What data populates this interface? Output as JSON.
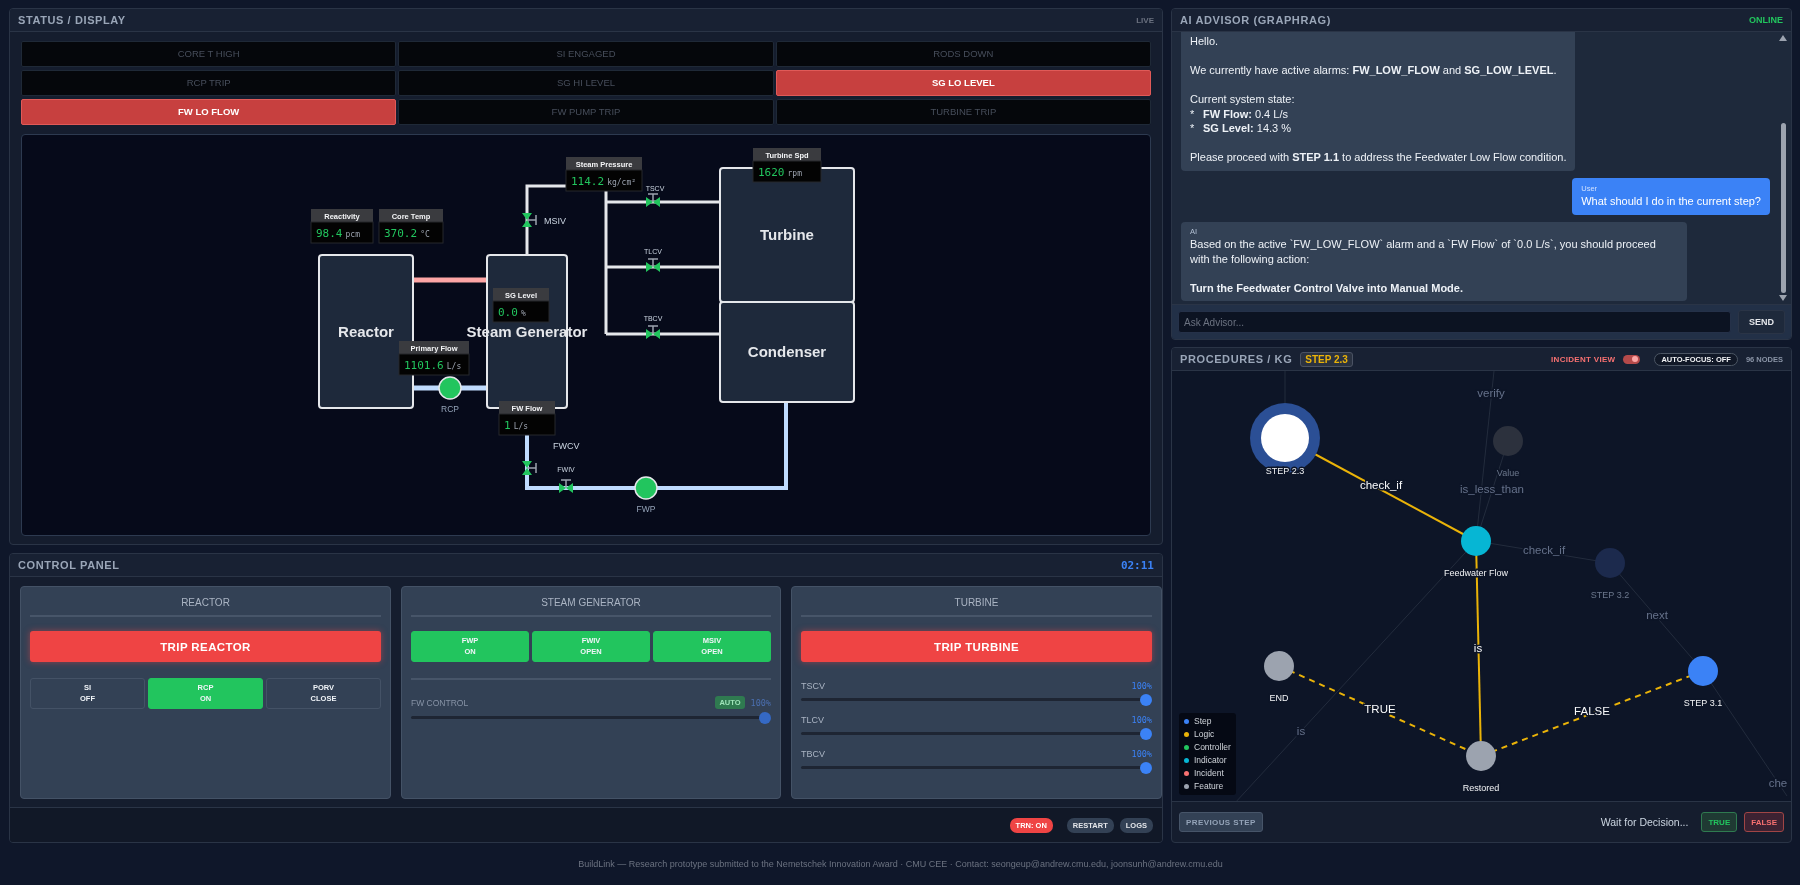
{
  "status_panel": {
    "title": "STATUS / DISPLAY",
    "badge": "LIVE",
    "alarms": [
      {
        "label": "CORE T HIGH",
        "active": false
      },
      {
        "label": "SI ENGAGED",
        "active": false
      },
      {
        "label": "RODS DOWN",
        "active": false
      },
      {
        "label": "RCP TRIP",
        "active": false
      },
      {
        "label": "SG HI LEVEL",
        "active": false
      },
      {
        "label": "SG LO LEVEL",
        "active": true
      },
      {
        "label": "FW LO FLOW",
        "active": true
      },
      {
        "label": "FW PUMP TRIP",
        "active": false
      },
      {
        "label": "TURBINE TRIP",
        "active": false
      }
    ],
    "diagram": {
      "components": [
        {
          "label": "Reactor"
        },
        {
          "label": "Steam Generator"
        },
        {
          "label": "Turbine"
        },
        {
          "label": "Condenser"
        }
      ],
      "gauges": [
        {
          "label": "Turbine Spd",
          "value": "1620",
          "unit": "rpm"
        },
        {
          "label": "Steam Pressure",
          "value": "114.2",
          "unit": "kg/cm²"
        },
        {
          "label": "Reactivity",
          "value": "98.4",
          "unit": "pcm"
        },
        {
          "label": "Core Temp",
          "value": "370.2",
          "unit": "°C"
        },
        {
          "label": "SG Level",
          "value": "0.0",
          "unit": "%"
        },
        {
          "label": "Primary Flow",
          "value": "1101.6",
          "unit": "L/s"
        },
        {
          "label": "FW Flow",
          "value": "1",
          "unit": "L/s"
        }
      ],
      "valves": [
        {
          "label": "MSIV",
          "open": true
        },
        {
          "label": "TSCV",
          "open": true
        },
        {
          "label": "TLCV",
          "open": true
        },
        {
          "label": "TBCV",
          "open": true
        },
        {
          "label": "FWCV",
          "open": true
        },
        {
          "label": "FWIV",
          "open": true
        }
      ],
      "pumps": [
        {
          "label": "RCP",
          "running": true
        },
        {
          "label": "FWP",
          "running": true
        }
      ]
    }
  },
  "control_panel": {
    "title": "CONTROL PANEL",
    "clock": "02:11",
    "sections": [
      {
        "title": "REACTOR",
        "trip_button": "TRIP REACTOR",
        "toggles": [
          {
            "name": "SI",
            "state": "OFF",
            "on": false
          },
          {
            "name": "RCP",
            "state": "ON",
            "on": true
          },
          {
            "name": "PORV",
            "state": "CLOSE",
            "on": false
          }
        ]
      },
      {
        "title": "STEAM GENERATOR",
        "toggles": [
          {
            "name": "FWP",
            "state": "ON",
            "on": true
          },
          {
            "name": "FWIV",
            "state": "OPEN",
            "on": true
          },
          {
            "name": "MSIV",
            "state": "OPEN",
            "on": true
          }
        ],
        "control": {
          "label": "FW CONTROL",
          "mode": "AUTO",
          "auto": true,
          "reading": "100%",
          "level": 1
        }
      },
      {
        "title": "TURBINE",
        "trip_button": "TRIP TURBINE",
        "sliders": [
          {
            "label": "TSCV",
            "reading": "100%",
            "level": 1
          },
          {
            "label": "TLCV",
            "reading": "100%",
            "level": 1
          },
          {
            "label": "TBCV",
            "reading": "100%",
            "level": 1
          }
        ]
      }
    ],
    "footer_buttons": [
      {
        "label": "TRN: ON",
        "kind": "alert"
      },
      {
        "label": "RESTART",
        "kind": "plain"
      },
      {
        "label": "LOGS",
        "kind": "plain"
      }
    ]
  },
  "advisor": {
    "title": "AI ADVISOR (GRAPHRAG)",
    "status": "ONLINE",
    "messages": [
      {
        "kind": "ai",
        "blocks": [
          {
            "kind": "text",
            "text": "Hello."
          },
          {
            "kind": "text",
            "text": "We currently have active alarms: **FW_LOW_FLOW** and **SG_LOW_LEVEL**."
          },
          {
            "kind": "text",
            "text": "Current system state:"
          },
          {
            "kind": "bullet",
            "mark": "*",
            "text": "**FW Flow:** 0.4 L/s"
          },
          {
            "kind": "bullet",
            "mark": "*",
            "text": "**SG Level:** 14.3 %"
          },
          {
            "kind": "text",
            "text": "Please proceed with **STEP 1.1** to address the Feedwater Low Flow condition."
          }
        ]
      },
      {
        "kind": "user",
        "sender": "User",
        "blocks": [
          {
            "kind": "text",
            "text": "What should I do in the current step?"
          }
        ]
      },
      {
        "kind": "ai",
        "sender": "AI",
        "blocks": [
          {
            "kind": "text",
            "text": "Based on the active `FW_LOW_FLOW` alarm and a `FW Flow` of `0.0 L/s`, you should proceed with the following action:"
          },
          {
            "kind": "strong",
            "text": "Turn the Feedwater Control Valve into Manual Mode."
          }
        ]
      }
    ],
    "input": {
      "placeholder": "Ask Advisor..."
    },
    "send_button": "SEND"
  },
  "procedures": {
    "title": "PROCEDURES / KG",
    "step_badge": "STEP 2.3",
    "incident_view": {
      "label": "INCIDENT VIEW",
      "on": true
    },
    "auto_focus": "AUTO-FOCUS: OFF",
    "node_count": "96 NODES",
    "graph": {
      "nodes": [
        {
          "label": "STEP 2.3",
          "color": "#2b4f95",
          "current": true,
          "faded": false
        },
        {
          "label": "Value",
          "color": "#2c313d",
          "current": false,
          "faded": true
        },
        {
          "label": "Feedwater Flow",
          "color": "#06b6d4",
          "current": false,
          "faded": false
        },
        {
          "label": "STEP 3.2",
          "color": "#1c2a4d",
          "current": false,
          "faded": true
        },
        {
          "label": "END",
          "color": "#9ca3af",
          "current": false,
          "faded": false
        },
        {
          "label": "STEP 3.1",
          "color": "#3b82f6",
          "current": false,
          "faded": false
        },
        {
          "label": "Restored",
          "color": "#9ca3af",
          "current": false,
          "faded": false
        }
      ],
      "edges": [
        {
          "label": "check_if",
          "kind": "solid",
          "faded": false
        },
        {
          "label": "is",
          "kind": "solid",
          "faded": false
        },
        {
          "label": "TRUE",
          "kind": "dashed",
          "faded": false
        },
        {
          "label": "FALSE",
          "kind": "dashed",
          "faded": false
        },
        {
          "label": "verify",
          "kind": "solid",
          "faded": true
        },
        {
          "label": "is_less_than",
          "kind": "solid",
          "faded": true
        },
        {
          "label": "check_if",
          "kind": "solid",
          "faded": true
        },
        {
          "label": "next",
          "kind": "solid",
          "faded": true
        },
        {
          "label": "is",
          "kind": "solid",
          "faded": true
        },
        {
          "label": "che",
          "kind": "solid",
          "faded": true
        }
      ],
      "legend": [
        {
          "label": "Step",
          "color": "#3b82f6"
        },
        {
          "label": "Logic",
          "color": "#eab308"
        },
        {
          "label": "Controller",
          "color": "#22c55e"
        },
        {
          "label": "Indicator",
          "color": "#06b6d4"
        },
        {
          "label": "Incident",
          "color": "#f87171"
        },
        {
          "label": "Feature",
          "color": "#9ca3af"
        }
      ]
    },
    "previous_button": "PREVIOUS STEP",
    "decision_text": "Wait for Decision...",
    "true_button": "TRUE",
    "false_button": "FALSE"
  },
  "footer": "BuildLink — Research prototype submitted to the Nemetschek Innovation Award · CMU CEE · Contact: seongeup@andrew.cmu.edu, joonsunh@andrew.cmu.edu"
}
